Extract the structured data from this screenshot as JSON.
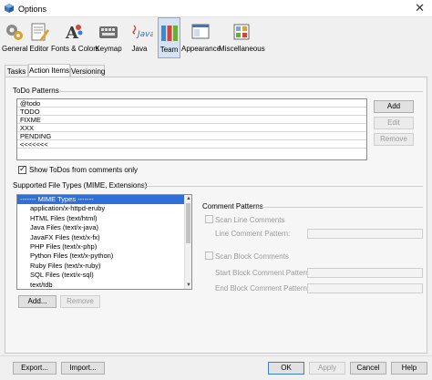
{
  "window": {
    "title": "Options",
    "close_glyph": "✕"
  },
  "toolbar": {
    "items": [
      {
        "label": "General",
        "icon": "general-icon"
      },
      {
        "label": "Editor",
        "icon": "editor-icon"
      },
      {
        "label": "Fonts & Colors",
        "icon": "fonts-colors-icon"
      },
      {
        "label": "Keymap",
        "icon": "keymap-icon"
      },
      {
        "label": "Java",
        "icon": "java-icon",
        "icon_text": "Java"
      },
      {
        "label": "Team",
        "icon": "team-icon",
        "active": true
      },
      {
        "label": "Appearance",
        "icon": "appearance-icon"
      },
      {
        "label": "Miscellaneous",
        "icon": "miscellaneous-icon"
      }
    ]
  },
  "tabs": [
    {
      "label": "Tasks"
    },
    {
      "label": "Action Items",
      "active": true
    },
    {
      "label": "Versioning"
    }
  ],
  "todo": {
    "section_label": "ToDo Patterns",
    "patterns": [
      "@todo",
      "TODO",
      "FIXME",
      "XXX",
      "PENDING",
      "<<<<<<<"
    ],
    "add_label": "Add",
    "edit_label": "Edit",
    "remove_label": "Remove",
    "show_todos_label": "Show ToDos from comments only",
    "show_todos_checked": true
  },
  "filetypes": {
    "section_label": "Supported File Types (MIME, Extensions)",
    "items": [
      {
        "label": "------- MIME Types -------",
        "selected": true
      },
      {
        "label": "application/x-httpd-eruby"
      },
      {
        "label": "HTML Files (text/html)"
      },
      {
        "label": "Java Files (text/x-java)"
      },
      {
        "label": "JavaFX Files (text/x-fx)"
      },
      {
        "label": "PHP Files (text/x-php)"
      },
      {
        "label": "Python Files (text/x-python)"
      },
      {
        "label": "Ruby Files (text/x-ruby)"
      },
      {
        "label": "SQL Files (text/x-sql)"
      },
      {
        "label": "text/tdb"
      }
    ],
    "add_label": "Add...",
    "remove_label": "Remove"
  },
  "comments": {
    "section_label": "Comment Patterns",
    "scan_line_label": "Scan Line Comments",
    "line_pattern_label": "Line Comment Pattern:",
    "scan_block_label": "Scan Block Comments",
    "start_block_label": "Start Block Comment Pattern:",
    "end_block_label": "End Block Comment Pattern:"
  },
  "footer": {
    "export_label": "Export...",
    "import_label": "Import...",
    "ok_label": "OK",
    "apply_label": "Apply",
    "cancel_label": "Cancel",
    "help_label": "Help"
  },
  "colors": {
    "accent": "#2f6fd8",
    "active_tab_bg": "#d5e2f5",
    "disabled_text": "#9a9a9a"
  }
}
